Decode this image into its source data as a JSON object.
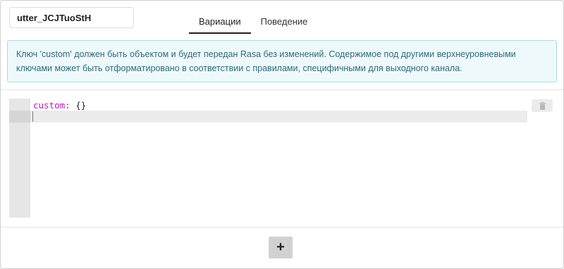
{
  "response_name": "utter_JCJTuoStH",
  "tabs": [
    {
      "label": "Вариации",
      "active": true
    },
    {
      "label": "Поведение",
      "active": false
    }
  ],
  "info_text": "Ключ 'custom' должен быть объектом и будет передан Rasa без изменений. Содержимое под другими верхнеуровневыми ключами может быть отформатировано в соответствии с правилами, специфичными для выходного канала.",
  "editor": {
    "key": "custom:",
    "value": " {}"
  },
  "icons": {
    "delete": "trash-icon",
    "add": "plus-icon"
  },
  "add_label": "+",
  "colors": {
    "info_bg": "#eef9fc",
    "info_border": "#a9dde8",
    "info_text": "#2b6d80",
    "yaml_key": "#c418b8"
  }
}
